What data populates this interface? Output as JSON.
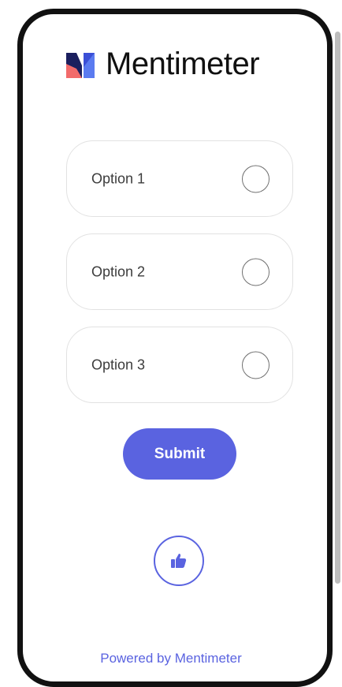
{
  "brand": {
    "name": "Mentimeter",
    "accent_color": "#5a63e0"
  },
  "options": [
    {
      "label": "Option 1",
      "selected": false
    },
    {
      "label": "Option 2",
      "selected": false
    },
    {
      "label": "Option 3",
      "selected": false
    }
  ],
  "submit_label": "Submit",
  "reaction_icon": "thumbs-up-icon",
  "footer": {
    "powered_by": "Powered by Mentimeter"
  }
}
